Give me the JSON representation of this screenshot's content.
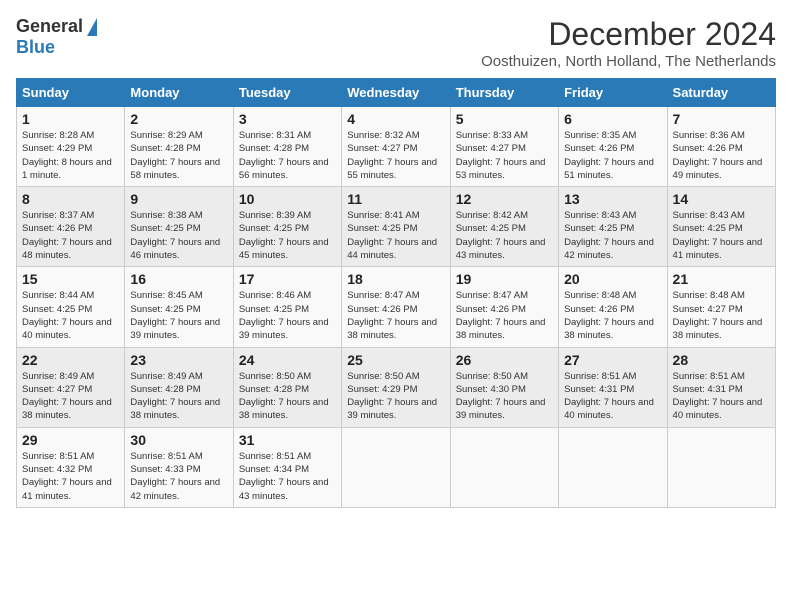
{
  "header": {
    "logo_general": "General",
    "logo_blue": "Blue",
    "month_title": "December 2024",
    "location": "Oosthuizen, North Holland, The Netherlands"
  },
  "days_of_week": [
    "Sunday",
    "Monday",
    "Tuesday",
    "Wednesday",
    "Thursday",
    "Friday",
    "Saturday"
  ],
  "weeks": [
    [
      {
        "day": "1",
        "sunrise": "8:28 AM",
        "sunset": "4:29 PM",
        "daylight": "8 hours and 1 minute."
      },
      {
        "day": "2",
        "sunrise": "8:29 AM",
        "sunset": "4:28 PM",
        "daylight": "7 hours and 58 minutes."
      },
      {
        "day": "3",
        "sunrise": "8:31 AM",
        "sunset": "4:28 PM",
        "daylight": "7 hours and 56 minutes."
      },
      {
        "day": "4",
        "sunrise": "8:32 AM",
        "sunset": "4:27 PM",
        "daylight": "7 hours and 55 minutes."
      },
      {
        "day": "5",
        "sunrise": "8:33 AM",
        "sunset": "4:27 PM",
        "daylight": "7 hours and 53 minutes."
      },
      {
        "day": "6",
        "sunrise": "8:35 AM",
        "sunset": "4:26 PM",
        "daylight": "7 hours and 51 minutes."
      },
      {
        "day": "7",
        "sunrise": "8:36 AM",
        "sunset": "4:26 PM",
        "daylight": "7 hours and 49 minutes."
      }
    ],
    [
      {
        "day": "8",
        "sunrise": "8:37 AM",
        "sunset": "4:26 PM",
        "daylight": "7 hours and 48 minutes."
      },
      {
        "day": "9",
        "sunrise": "8:38 AM",
        "sunset": "4:25 PM",
        "daylight": "7 hours and 46 minutes."
      },
      {
        "day": "10",
        "sunrise": "8:39 AM",
        "sunset": "4:25 PM",
        "daylight": "7 hours and 45 minutes."
      },
      {
        "day": "11",
        "sunrise": "8:41 AM",
        "sunset": "4:25 PM",
        "daylight": "7 hours and 44 minutes."
      },
      {
        "day": "12",
        "sunrise": "8:42 AM",
        "sunset": "4:25 PM",
        "daylight": "7 hours and 43 minutes."
      },
      {
        "day": "13",
        "sunrise": "8:43 AM",
        "sunset": "4:25 PM",
        "daylight": "7 hours and 42 minutes."
      },
      {
        "day": "14",
        "sunrise": "8:43 AM",
        "sunset": "4:25 PM",
        "daylight": "7 hours and 41 minutes."
      }
    ],
    [
      {
        "day": "15",
        "sunrise": "8:44 AM",
        "sunset": "4:25 PM",
        "daylight": "7 hours and 40 minutes."
      },
      {
        "day": "16",
        "sunrise": "8:45 AM",
        "sunset": "4:25 PM",
        "daylight": "7 hours and 39 minutes."
      },
      {
        "day": "17",
        "sunrise": "8:46 AM",
        "sunset": "4:25 PM",
        "daylight": "7 hours and 39 minutes."
      },
      {
        "day": "18",
        "sunrise": "8:47 AM",
        "sunset": "4:26 PM",
        "daylight": "7 hours and 38 minutes."
      },
      {
        "day": "19",
        "sunrise": "8:47 AM",
        "sunset": "4:26 PM",
        "daylight": "7 hours and 38 minutes."
      },
      {
        "day": "20",
        "sunrise": "8:48 AM",
        "sunset": "4:26 PM",
        "daylight": "7 hours and 38 minutes."
      },
      {
        "day": "21",
        "sunrise": "8:48 AM",
        "sunset": "4:27 PM",
        "daylight": "7 hours and 38 minutes."
      }
    ],
    [
      {
        "day": "22",
        "sunrise": "8:49 AM",
        "sunset": "4:27 PM",
        "daylight": "7 hours and 38 minutes."
      },
      {
        "day": "23",
        "sunrise": "8:49 AM",
        "sunset": "4:28 PM",
        "daylight": "7 hours and 38 minutes."
      },
      {
        "day": "24",
        "sunrise": "8:50 AM",
        "sunset": "4:28 PM",
        "daylight": "7 hours and 38 minutes."
      },
      {
        "day": "25",
        "sunrise": "8:50 AM",
        "sunset": "4:29 PM",
        "daylight": "7 hours and 39 minutes."
      },
      {
        "day": "26",
        "sunrise": "8:50 AM",
        "sunset": "4:30 PM",
        "daylight": "7 hours and 39 minutes."
      },
      {
        "day": "27",
        "sunrise": "8:51 AM",
        "sunset": "4:31 PM",
        "daylight": "7 hours and 40 minutes."
      },
      {
        "day": "28",
        "sunrise": "8:51 AM",
        "sunset": "4:31 PM",
        "daylight": "7 hours and 40 minutes."
      }
    ],
    [
      {
        "day": "29",
        "sunrise": "8:51 AM",
        "sunset": "4:32 PM",
        "daylight": "7 hours and 41 minutes."
      },
      {
        "day": "30",
        "sunrise": "8:51 AM",
        "sunset": "4:33 PM",
        "daylight": "7 hours and 42 minutes."
      },
      {
        "day": "31",
        "sunrise": "8:51 AM",
        "sunset": "4:34 PM",
        "daylight": "7 hours and 43 minutes."
      },
      null,
      null,
      null,
      null
    ]
  ]
}
